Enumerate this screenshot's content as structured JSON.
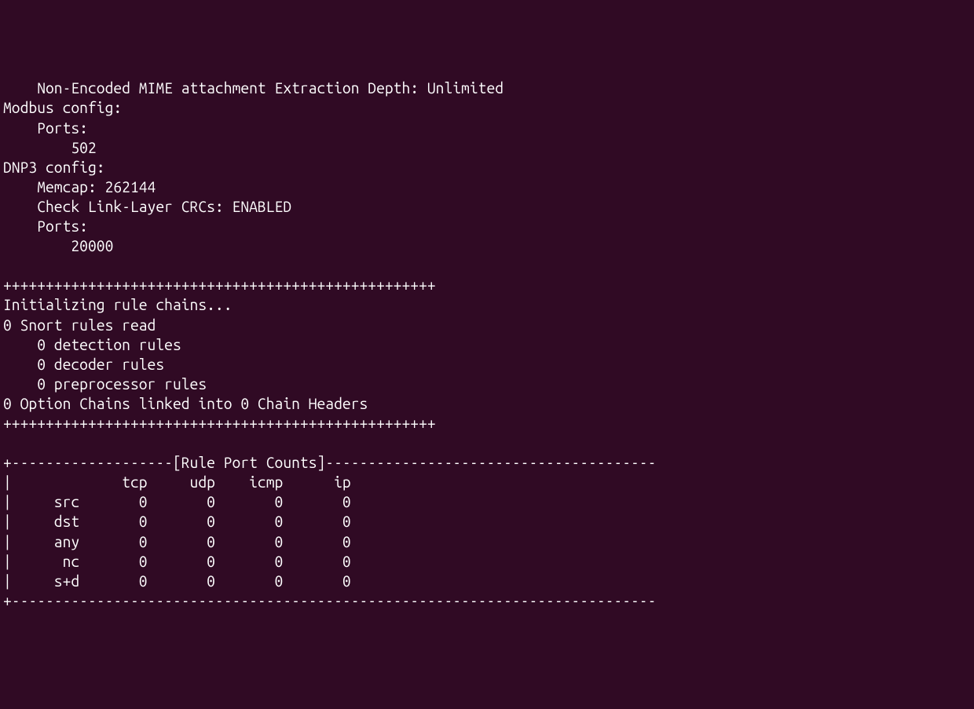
{
  "config": {
    "mime_line": "    Non-Encoded MIME attachment Extraction Depth: Unlimited",
    "modbus_header": "Modbus config:",
    "modbus_ports_lbl": "    Ports:",
    "modbus_port": "        502",
    "dnp3_header": "DNP3 config:",
    "dnp3_memcap": "    Memcap: 262144",
    "dnp3_crc": "    Check Link-Layer CRCs: ENABLED",
    "dnp3_ports_lbl": "    Ports:",
    "dnp3_port": "        20000"
  },
  "sep": {
    "plus": "+++++++++++++++++++++++++++++++++++++++++++++++++++"
  },
  "rules": {
    "init": "Initializing rule chains...",
    "read": "0 Snort rules read",
    "det": "    0 detection rules",
    "dec": "    0 decoder rules",
    "prep": "    0 preprocessor rules",
    "chains": "0 Option Chains linked into 0 Chain Headers"
  },
  "table": {
    "top": "+-------------------[Rule Port Counts]---------------------------------------",
    "hdr": "|             tcp     udp    icmp      ip",
    "src": "|     src       0       0       0       0",
    "dst": "|     dst       0       0       0       0",
    "any": "|     any       0       0       0       0",
    "nc": "|      nc       0       0       0       0",
    "sd": "|     s+d       0       0       0       0",
    "bottom": "+----------------------------------------------------------------------------"
  },
  "chart_data": {
    "type": "table",
    "title": "Rule Port Counts",
    "columns": [
      "tcp",
      "udp",
      "icmp",
      "ip"
    ],
    "rows": [
      {
        "label": "src",
        "values": [
          0,
          0,
          0,
          0
        ]
      },
      {
        "label": "dst",
        "values": [
          0,
          0,
          0,
          0
        ]
      },
      {
        "label": "any",
        "values": [
          0,
          0,
          0,
          0
        ]
      },
      {
        "label": "nc",
        "values": [
          0,
          0,
          0,
          0
        ]
      },
      {
        "label": "s+d",
        "values": [
          0,
          0,
          0,
          0
        ]
      }
    ]
  }
}
